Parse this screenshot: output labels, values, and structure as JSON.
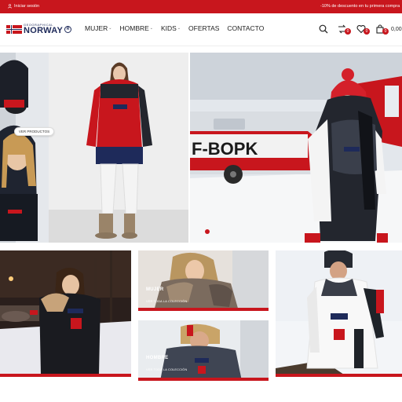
{
  "topbar": {
    "login_label": "Iniciar sesión",
    "promo_text": "-10% de descuento en tu primera compra"
  },
  "brand": {
    "logo_top": "GEOGRAPHICAL",
    "logo_main": "NORWAY",
    "logo_mark": "R"
  },
  "nav": {
    "items": [
      {
        "label": "MUJER",
        "has_dropdown": true
      },
      {
        "label": "HOMBRE",
        "has_dropdown": true
      },
      {
        "label": "KIDS",
        "has_dropdown": true
      },
      {
        "label": "OFERTAS",
        "has_dropdown": false
      },
      {
        "label": "CONTACTO",
        "has_dropdown": false
      }
    ],
    "dropdown_glyph": "⌄"
  },
  "header_icons": {
    "search_icon": "search-icon",
    "compare_icon": "compare-icon",
    "compare_count": "0",
    "wishlist_icon": "heart-icon",
    "wishlist_count": "0",
    "cart_icon": "bag-icon",
    "cart_count": "0",
    "cart_total": "0,00 €"
  },
  "hero": {
    "cta_label": "VER PRODUCTOS",
    "plane_text": "F-BOPK",
    "active_slide": 1
  },
  "tiles": {
    "women_title": "MUJER",
    "women_sub": "VER TODA LA COLECCIÓN",
    "men_title": "HOMBRE",
    "men_sub": "VER TODA LA COLECCIÓN"
  },
  "colors": {
    "brand_red": "#c8161d",
    "navy": "#1e2a5a"
  }
}
